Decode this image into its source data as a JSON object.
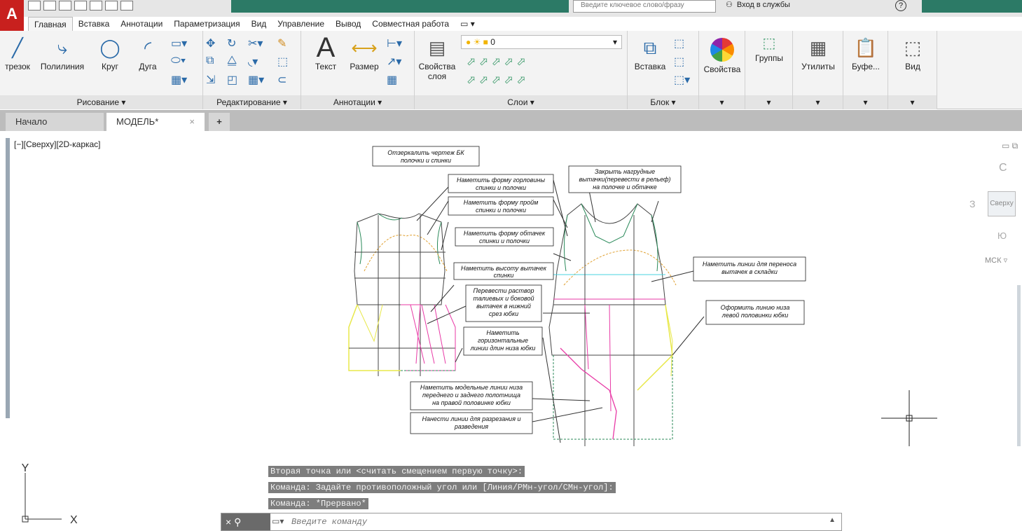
{
  "titlebar": {
    "search_placeholder": "Введите ключевое слово/фразу",
    "signin_label": "Вход в службы",
    "help_icon": "?"
  },
  "ribbon_tabs": [
    "Главная",
    "Вставка",
    "Аннотации",
    "Параметризация",
    "Вид",
    "Управление",
    "Вывод",
    "Совместная работа",
    "▭ ▾"
  ],
  "ribbon": {
    "draw": {
      "title": "Рисование ▾",
      "tools": [
        "трезок",
        "Полилиния",
        "Круг",
        "Дуга"
      ]
    },
    "modify": {
      "title": "Редактирование ▾"
    },
    "annotation": {
      "title": "Аннотации ▾",
      "text": "Текст",
      "dimension": "Размер"
    },
    "layers": {
      "title": "Слои ▾",
      "props_line1": "Свойства",
      "props_line2": "слоя",
      "current_layer": "0"
    },
    "block": {
      "title": "Блок ▾",
      "insert": "Вставка"
    },
    "properties": {
      "label": "Свойства"
    },
    "groups": {
      "label": "Группы"
    },
    "utilities": {
      "label": "Утилиты"
    },
    "clipboard": {
      "label": "Буфе..."
    },
    "view": {
      "label": "Вид"
    }
  },
  "doc_tabs": {
    "start": "Начало",
    "model": "МОДЕЛЬ*",
    "close": "×",
    "add": "+"
  },
  "viewport_label": "[−][Сверху][2D-каркас]",
  "viewcube": {
    "restore": "▭ ⧉",
    "north": "С",
    "west": "З",
    "face": "Сверху",
    "south": "Ю",
    "ucs": "МСК ▿"
  },
  "ucs_icon": {
    "y": "Y",
    "x": "X"
  },
  "drawing_notes": {
    "n1": [
      "Отзеркалить чертеж БК",
      "полочки и спинки"
    ],
    "n2": [
      "Наметить форму горловины",
      "спинки и полочки"
    ],
    "n3": [
      "Наметить форму пройм",
      "спинки и полочки"
    ],
    "n4": [
      "Наметить форму обтачек",
      "спинки и полочки"
    ],
    "n5": [
      "Наметить высоту вытачек",
      "спинки"
    ],
    "n6": [
      "Перевести раствор",
      "талиевых и боковой",
      "вытачек в нижний",
      "срез юбки"
    ],
    "n7": [
      "Наметить",
      "горизонтальные",
      "линии длин низа юбки"
    ],
    "n8": [
      "Наметить модельные  линии низа",
      "переднего и заднего полотнища",
      "на правой половинке юбки"
    ],
    "n9": [
      "Нанести линии для разрезания и",
      "разведения"
    ],
    "n10": [
      "Закрыть нагрудные",
      "вытачки(перевести в рельеф)",
      "на полочке и обтачке"
    ],
    "n11": [
      "Наметить линии для переноса",
      "вытачек  в складки"
    ],
    "n12": [
      "Оформить линию низа",
      "левой половинки юбки"
    ]
  },
  "command": {
    "history": [
      "Вторая точка или <считать смещением первую точку>:",
      "Команда: Задайте противоположный угол или [Линия/РМн-угол/СМн-угол]:",
      "Команда: *Прервано*"
    ],
    "handle": "× ⚲",
    "prompt_icon": "▭▾",
    "placeholder": "Введите команду",
    "expand": "▲"
  }
}
